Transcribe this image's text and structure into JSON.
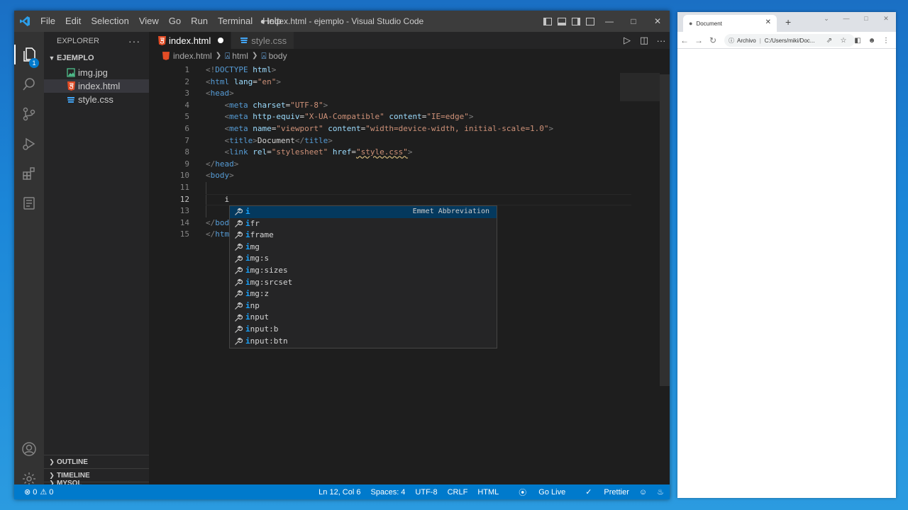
{
  "vscode": {
    "menu": [
      "File",
      "Edit",
      "Selection",
      "View",
      "Go",
      "Run",
      "Terminal",
      "Help"
    ],
    "window_title": "● index.html - ejemplo - Visual Studio Code",
    "activity_badge": "1",
    "explorer": {
      "title": "EXPLORER",
      "folder": "EJEMPLO",
      "files": [
        {
          "name": "img.jpg",
          "type": "image"
        },
        {
          "name": "index.html",
          "type": "html",
          "active": true
        },
        {
          "name": "style.css",
          "type": "css"
        }
      ],
      "sections": [
        "OUTLINE",
        "TIMELINE",
        "MYSQL"
      ]
    },
    "tabs": [
      {
        "label": "index.html",
        "type": "html",
        "active": true,
        "modified": true
      },
      {
        "label": "style.css",
        "type": "css",
        "active": false
      }
    ],
    "breadcrumb": [
      "index.html",
      "html",
      "body"
    ],
    "code_lines": [
      {
        "n": "1",
        "tokens": [
          [
            "t",
            "<!"
          ],
          [
            "tn",
            "DOCTYPE"
          ],
          [
            "an",
            " html"
          ],
          [
            "t",
            ">"
          ]
        ]
      },
      {
        "n": "2",
        "tokens": [
          [
            "t",
            "<"
          ],
          [
            "tn",
            "html"
          ],
          [
            "an",
            " lang"
          ],
          [
            "tx",
            "="
          ],
          [
            "av",
            "\"en\""
          ],
          [
            "t",
            ">"
          ]
        ]
      },
      {
        "n": "3",
        "tokens": [
          [
            "t",
            "<"
          ],
          [
            "tn",
            "head"
          ],
          [
            "t",
            ">"
          ]
        ]
      },
      {
        "n": "4",
        "tokens": [
          [
            "tx",
            "    "
          ],
          [
            "t",
            "<"
          ],
          [
            "tn",
            "meta"
          ],
          [
            "an",
            " charset"
          ],
          [
            "tx",
            "="
          ],
          [
            "av",
            "\"UTF-8\""
          ],
          [
            "t",
            ">"
          ]
        ]
      },
      {
        "n": "5",
        "tokens": [
          [
            "tx",
            "    "
          ],
          [
            "t",
            "<"
          ],
          [
            "tn",
            "meta"
          ],
          [
            "an",
            " http-equiv"
          ],
          [
            "tx",
            "="
          ],
          [
            "av",
            "\"X-UA-Compatible\""
          ],
          [
            "an",
            " content"
          ],
          [
            "tx",
            "="
          ],
          [
            "av",
            "\"IE=edge\""
          ],
          [
            "t",
            ">"
          ]
        ]
      },
      {
        "n": "6",
        "tokens": [
          [
            "tx",
            "    "
          ],
          [
            "t",
            "<"
          ],
          [
            "tn",
            "meta"
          ],
          [
            "an",
            " name"
          ],
          [
            "tx",
            "="
          ],
          [
            "av",
            "\"viewport\""
          ],
          [
            "an",
            " content"
          ],
          [
            "tx",
            "="
          ],
          [
            "av",
            "\"width=device-width, initial-scale=1.0\""
          ],
          [
            "t",
            ">"
          ]
        ]
      },
      {
        "n": "7",
        "tokens": [
          [
            "tx",
            "    "
          ],
          [
            "t",
            "<"
          ],
          [
            "tn",
            "title"
          ],
          [
            "t",
            ">"
          ],
          [
            "tx",
            "Document"
          ],
          [
            "t",
            "</"
          ],
          [
            "tn",
            "title"
          ],
          [
            "t",
            ">"
          ]
        ]
      },
      {
        "n": "8",
        "tokens": [
          [
            "tx",
            "    "
          ],
          [
            "t",
            "<"
          ],
          [
            "tn",
            "link"
          ],
          [
            "an",
            " rel"
          ],
          [
            "tx",
            "="
          ],
          [
            "av",
            "\"stylesheet\""
          ],
          [
            "an",
            " href"
          ],
          [
            "tx",
            "="
          ],
          [
            "av",
            "\"style.css\""
          ],
          [
            "t",
            ">"
          ]
        ]
      },
      {
        "n": "9",
        "tokens": [
          [
            "t",
            "</"
          ],
          [
            "tn",
            "head"
          ],
          [
            "t",
            ">"
          ]
        ]
      },
      {
        "n": "10",
        "tokens": [
          [
            "t",
            "<"
          ],
          [
            "tn",
            "body"
          ],
          [
            "t",
            ">"
          ]
        ]
      },
      {
        "n": "11",
        "tokens": []
      },
      {
        "n": "12",
        "tokens": [
          [
            "tx",
            "    i"
          ]
        ],
        "current": true
      },
      {
        "n": "13",
        "tokens": []
      },
      {
        "n": "14",
        "tokens": [
          [
            "t",
            "</"
          ],
          [
            "tn",
            "bod"
          ]
        ]
      },
      {
        "n": "15",
        "tokens": [
          [
            "t",
            "</"
          ],
          [
            "tn",
            "htm"
          ]
        ]
      }
    ],
    "suggestions": [
      {
        "match": "i",
        "rest": "",
        "detail": "Emmet Abbreviation"
      },
      {
        "match": "i",
        "rest": "fr"
      },
      {
        "match": "i",
        "rest": "frame"
      },
      {
        "match": "i",
        "rest": "mg"
      },
      {
        "match": "i",
        "rest": "mg:s"
      },
      {
        "match": "i",
        "rest": "mg:sizes"
      },
      {
        "match": "i",
        "rest": "mg:srcset"
      },
      {
        "match": "i",
        "rest": "mg:z"
      },
      {
        "match": "i",
        "rest": "np"
      },
      {
        "match": "i",
        "rest": "nput"
      },
      {
        "match": "i",
        "rest": "nput:b"
      },
      {
        "match": "i",
        "rest": "nput:btn"
      }
    ],
    "status": {
      "errors": "0",
      "warnings": "0",
      "position": "Ln 12, Col 6",
      "spaces": "Spaces: 4",
      "encoding": "UTF-8",
      "eol": "CRLF",
      "language": "HTML",
      "golive": "Go Live",
      "prettier": "Prettier"
    }
  },
  "browser": {
    "tab_title": "Document",
    "security_label": "Archivo",
    "url": "C:/Users/miki/Doc..."
  }
}
